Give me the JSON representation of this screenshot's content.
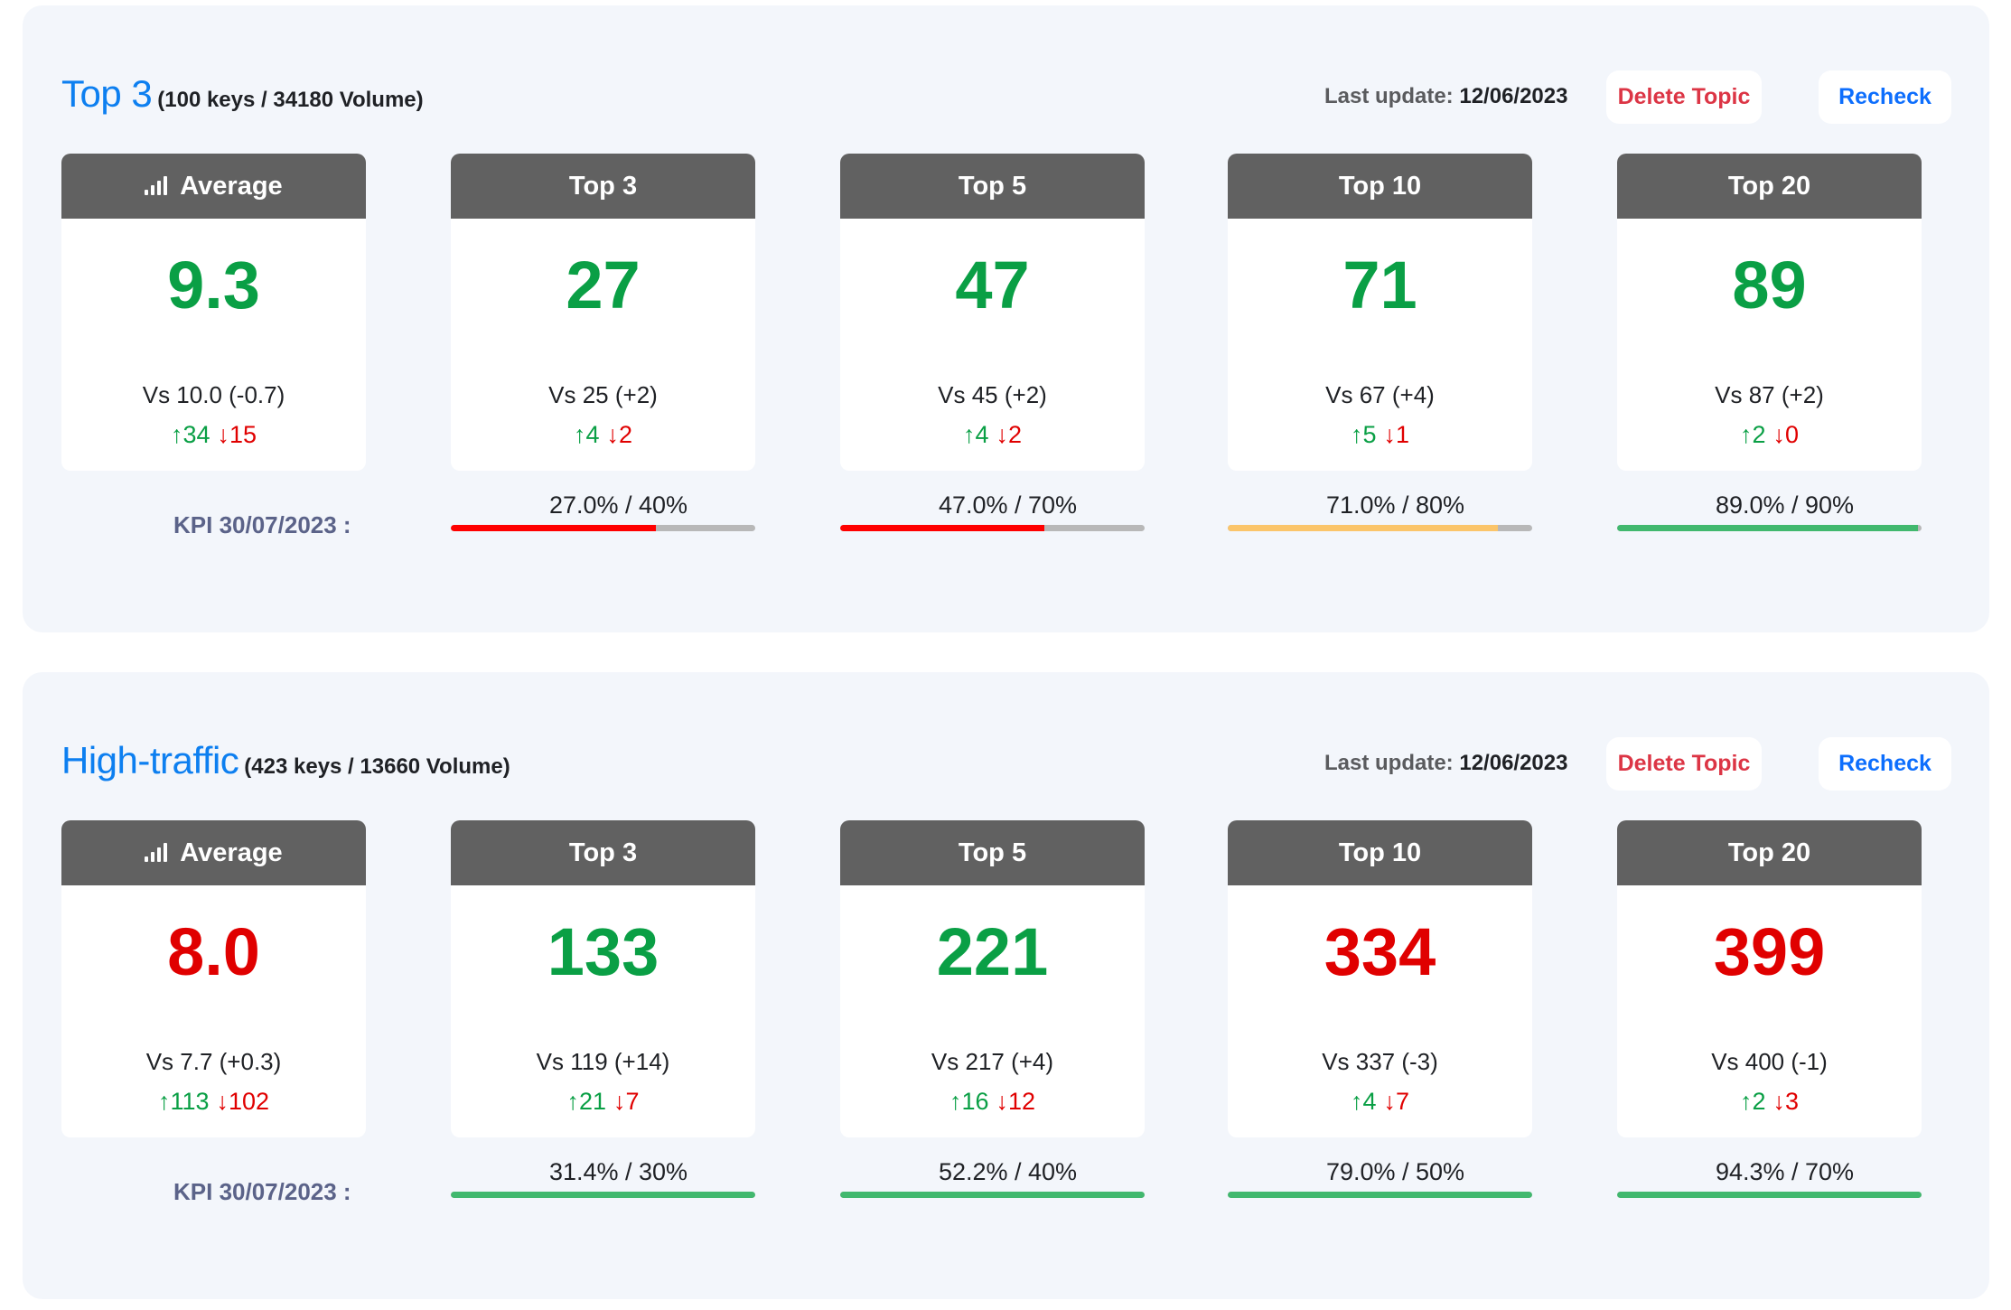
{
  "colors": {
    "good": "#0a9f45",
    "bad": "#e00000",
    "bar_red": "#ff0000",
    "bar_yellow": "#fbc56a",
    "bar_green": "#41b86e",
    "bar_track": "#b8b8b8"
  },
  "sections": [
    {
      "title": "Top 3",
      "subtitle": "(100 keys / 34180 Volume)",
      "last_update_label": "Last update:",
      "last_update_value": "12/06/2023",
      "delete_label": "Delete Topic",
      "recheck_label": "Recheck",
      "kpi_label": "KPI 30/07/2023 :",
      "cards": [
        {
          "header": "Average",
          "icon": "signal-bars-icon",
          "value": "9.3",
          "status": "good",
          "vs": "Vs 10.0 (-0.7)",
          "up": "↑34",
          "down": "↓15"
        },
        {
          "header": "Top 3",
          "value": "27",
          "status": "good",
          "vs": "Vs 25 (+2)",
          "up": "↑4",
          "down": "↓2",
          "kpi_text": "27.0% / 40%",
          "kpi_progress": 0.675,
          "kpi_color": "bar_red"
        },
        {
          "header": "Top 5",
          "value": "47",
          "status": "good",
          "vs": "Vs 45 (+2)",
          "up": "↑4",
          "down": "↓2",
          "kpi_text": "47.0% / 70%",
          "kpi_progress": 0.671,
          "kpi_color": "bar_red"
        },
        {
          "header": "Top 10",
          "value": "71",
          "status": "good",
          "vs": "Vs 67 (+4)",
          "up": "↑5",
          "down": "↓1",
          "kpi_text": "71.0% / 80%",
          "kpi_progress": 0.8875,
          "kpi_color": "bar_yellow"
        },
        {
          "header": "Top 20",
          "value": "89",
          "status": "good",
          "vs": "Vs 87 (+2)",
          "up": "↑2",
          "down": "↓0",
          "kpi_text": "89.0% / 90%",
          "kpi_progress": 0.989,
          "kpi_color": "bar_green"
        }
      ]
    },
    {
      "title": "High-traffic",
      "subtitle": "(423 keys / 13660 Volume)",
      "last_update_label": "Last update:",
      "last_update_value": "12/06/2023",
      "delete_label": "Delete Topic",
      "recheck_label": "Recheck",
      "kpi_label": "KPI 30/07/2023 :",
      "cards": [
        {
          "header": "Average",
          "icon": "signal-bars-icon",
          "value": "8.0",
          "status": "bad",
          "vs": "Vs 7.7 (+0.3)",
          "up": "↑113",
          "down": "↓102"
        },
        {
          "header": "Top 3",
          "value": "133",
          "status": "good",
          "vs": "Vs 119 (+14)",
          "up": "↑21",
          "down": "↓7",
          "kpi_text": "31.4% / 30%",
          "kpi_progress": 1.0,
          "kpi_color": "bar_green"
        },
        {
          "header": "Top 5",
          "value": "221",
          "status": "good",
          "vs": "Vs 217 (+4)",
          "up": "↑16",
          "down": "↓12",
          "kpi_text": "52.2% / 40%",
          "kpi_progress": 1.0,
          "kpi_color": "bar_green"
        },
        {
          "header": "Top 10",
          "value": "334",
          "status": "bad",
          "vs": "Vs 337 (-3)",
          "up": "↑4",
          "down": "↓7",
          "kpi_text": "79.0% / 50%",
          "kpi_progress": 1.0,
          "kpi_color": "bar_green"
        },
        {
          "header": "Top 20",
          "value": "399",
          "status": "bad",
          "vs": "Vs 400 (-1)",
          "up": "↑2",
          "down": "↓3",
          "kpi_text": "94.3% / 70%",
          "kpi_progress": 1.0,
          "kpi_color": "bar_green"
        }
      ]
    }
  ]
}
